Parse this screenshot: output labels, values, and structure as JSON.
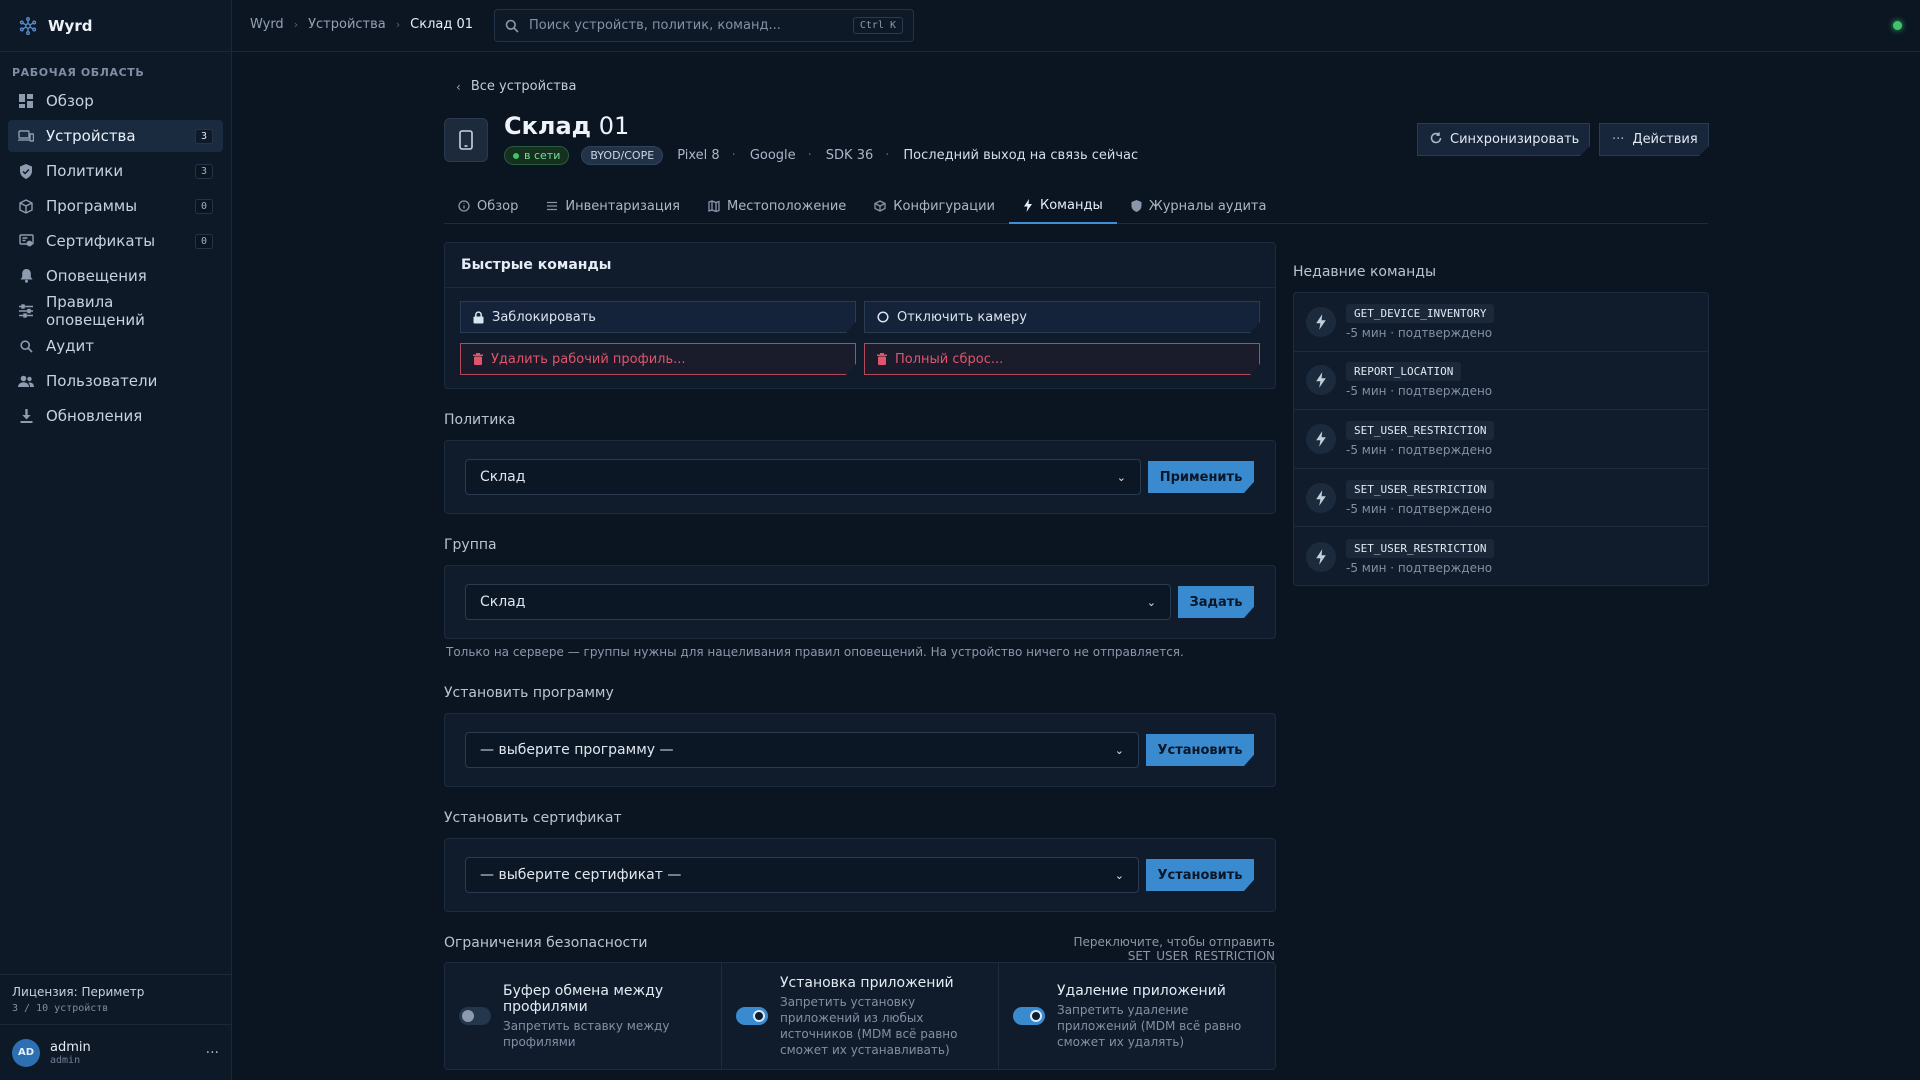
{
  "app": {
    "name": "Wyrd"
  },
  "sidebar": {
    "section_label": "РАБОЧАЯ ОБЛАСТЬ",
    "items": [
      {
        "label": "Обзор",
        "icon": "dashboard-icon"
      },
      {
        "label": "Устройства",
        "icon": "devices-icon",
        "count": "3",
        "active": true
      },
      {
        "label": "Политики",
        "icon": "shield-icon",
        "count": "3"
      },
      {
        "label": "Программы",
        "icon": "package-icon",
        "count": "0"
      },
      {
        "label": "Сертификаты",
        "icon": "certificate-icon",
        "count": "0"
      },
      {
        "label": "Оповещения",
        "icon": "bell-icon"
      },
      {
        "label": "Правила оповещений",
        "icon": "sliders-icon"
      },
      {
        "label": "Аудит",
        "icon": "search-icon"
      },
      {
        "label": "Пользователи",
        "icon": "users-icon"
      },
      {
        "label": "Обновления",
        "icon": "download-icon"
      }
    ],
    "license_title": "Лицензия: Периметр",
    "license_usage": "3 / 10 устройств",
    "user": {
      "initials": "AD",
      "name": "admin",
      "role": "admin",
      "more": "···"
    }
  },
  "topbar": {
    "breadcrumbs": [
      "Wyrd",
      "Устройства",
      "Склад 01"
    ],
    "search_placeholder": "Поиск устройств, политик, команд...",
    "search_shortcut": "Ctrl K",
    "status_color": "#3ec46d"
  },
  "device": {
    "back_label": "Все устройства",
    "title_bold": "Склад",
    "title_rest": " 01",
    "status": "в сети",
    "mode": "BYOD/COPE",
    "model": "Pixel 8",
    "vendor": "Google",
    "sdk": "SDK 36",
    "last_seen": "Последний выход на связь сейчас",
    "sync_label": "Синхронизировать",
    "actions_label": "Действия"
  },
  "tabs": [
    {
      "label": "Обзор",
      "icon": "info-icon"
    },
    {
      "label": "Инвентаризация",
      "icon": "list-icon"
    },
    {
      "label": "Местоположение",
      "icon": "map-icon"
    },
    {
      "label": "Конфигурации",
      "icon": "cube-icon"
    },
    {
      "label": "Команды",
      "icon": "bolt-icon",
      "active": true
    },
    {
      "label": "Журналы аудита",
      "icon": "shield-icon"
    }
  ],
  "quick": {
    "title": "Быстрые команды",
    "lock": "Заблокировать",
    "camera": "Отключить камеру",
    "wipe_profile": "Удалить рабочий профиль...",
    "factory_reset": "Полный сброс..."
  },
  "policy": {
    "label": "Политика",
    "value": "Склад",
    "button": "Применить"
  },
  "group": {
    "label": "Группа",
    "value": "Склад",
    "button": "Задать",
    "hint": "Только на сервере — группы нужны для нацеливания правил оповещений. На устройство ничего не отправляется."
  },
  "install_app": {
    "label": "Установить программу",
    "value": "— выберите программу —",
    "button": "Установить"
  },
  "install_cert": {
    "label": "Установить сертификат",
    "value": "— выберите сертификат —",
    "button": "Установить"
  },
  "security": {
    "label": "Ограничения безопасности",
    "hint": "Переключите, чтобы отправить SET_USER_RESTRICTION",
    "items": [
      {
        "name": "Буфер обмена между профилями",
        "desc": "Запретить вставку между профилями",
        "on": false
      },
      {
        "name": "Установка приложений",
        "desc": "Запретить установку приложений из любых источников (MDM всё равно сможет их устанавливать)",
        "on": true
      },
      {
        "name": "Удаление приложений",
        "desc": "Запретить удаление приложений (MDM всё равно сможет их удалять)",
        "on": true
      }
    ]
  },
  "recent": {
    "title": "Недавние команды",
    "items": [
      {
        "code": "GET_DEVICE_INVENTORY",
        "sub": "-5 мин · подтверждено"
      },
      {
        "code": "REPORT_LOCATION",
        "sub": "-5 мин · подтверждено"
      },
      {
        "code": "SET_USER_RESTRICTION",
        "sub": "-5 мин · подтверждено"
      },
      {
        "code": "SET_USER_RESTRICTION",
        "sub": "-5 мин · подтверждено"
      },
      {
        "code": "SET_USER_RESTRICTION",
        "sub": "-5 мин · подтверждено"
      }
    ]
  }
}
